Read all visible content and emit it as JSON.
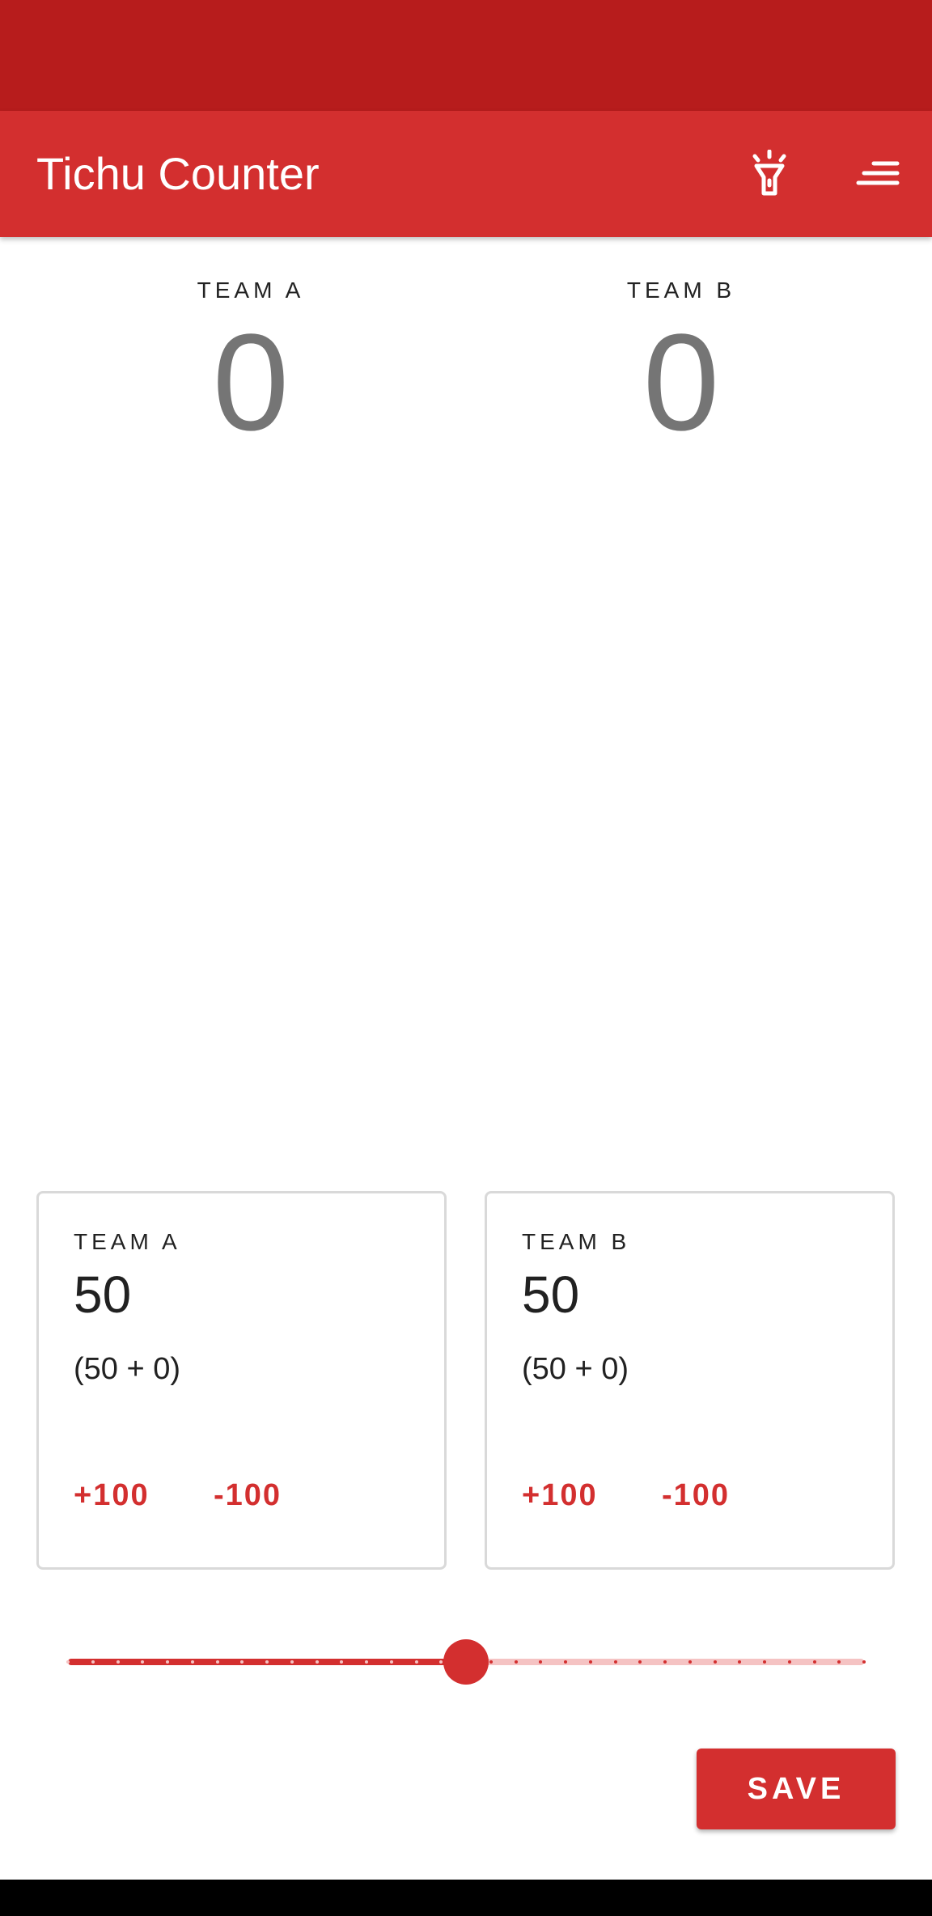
{
  "app": {
    "title": "Tichu Counter",
    "icons": [
      "flashlight-icon",
      "menu-icon"
    ],
    "colors": {
      "primary": "#d32f2f",
      "primary_dark": "#b71c1c",
      "track_light": "#f5c3c3",
      "score_gray": "#757575"
    }
  },
  "scoreboard": {
    "team_a": {
      "label": "TEAM A",
      "score": "0"
    },
    "team_b": {
      "label": "TEAM B",
      "score": "0"
    }
  },
  "round": {
    "team_a": {
      "label": "TEAM A",
      "total": "50",
      "breakdown": "(50 + 0)",
      "plus": "+100",
      "minus": "-100"
    },
    "team_b": {
      "label": "TEAM B",
      "total": "50",
      "breakdown": "(50 + 0)",
      "plus": "+100",
      "minus": "-100"
    }
  },
  "slider": {
    "value_fraction": 0.5,
    "steps": 32
  },
  "actions": {
    "save": "SAVE"
  }
}
